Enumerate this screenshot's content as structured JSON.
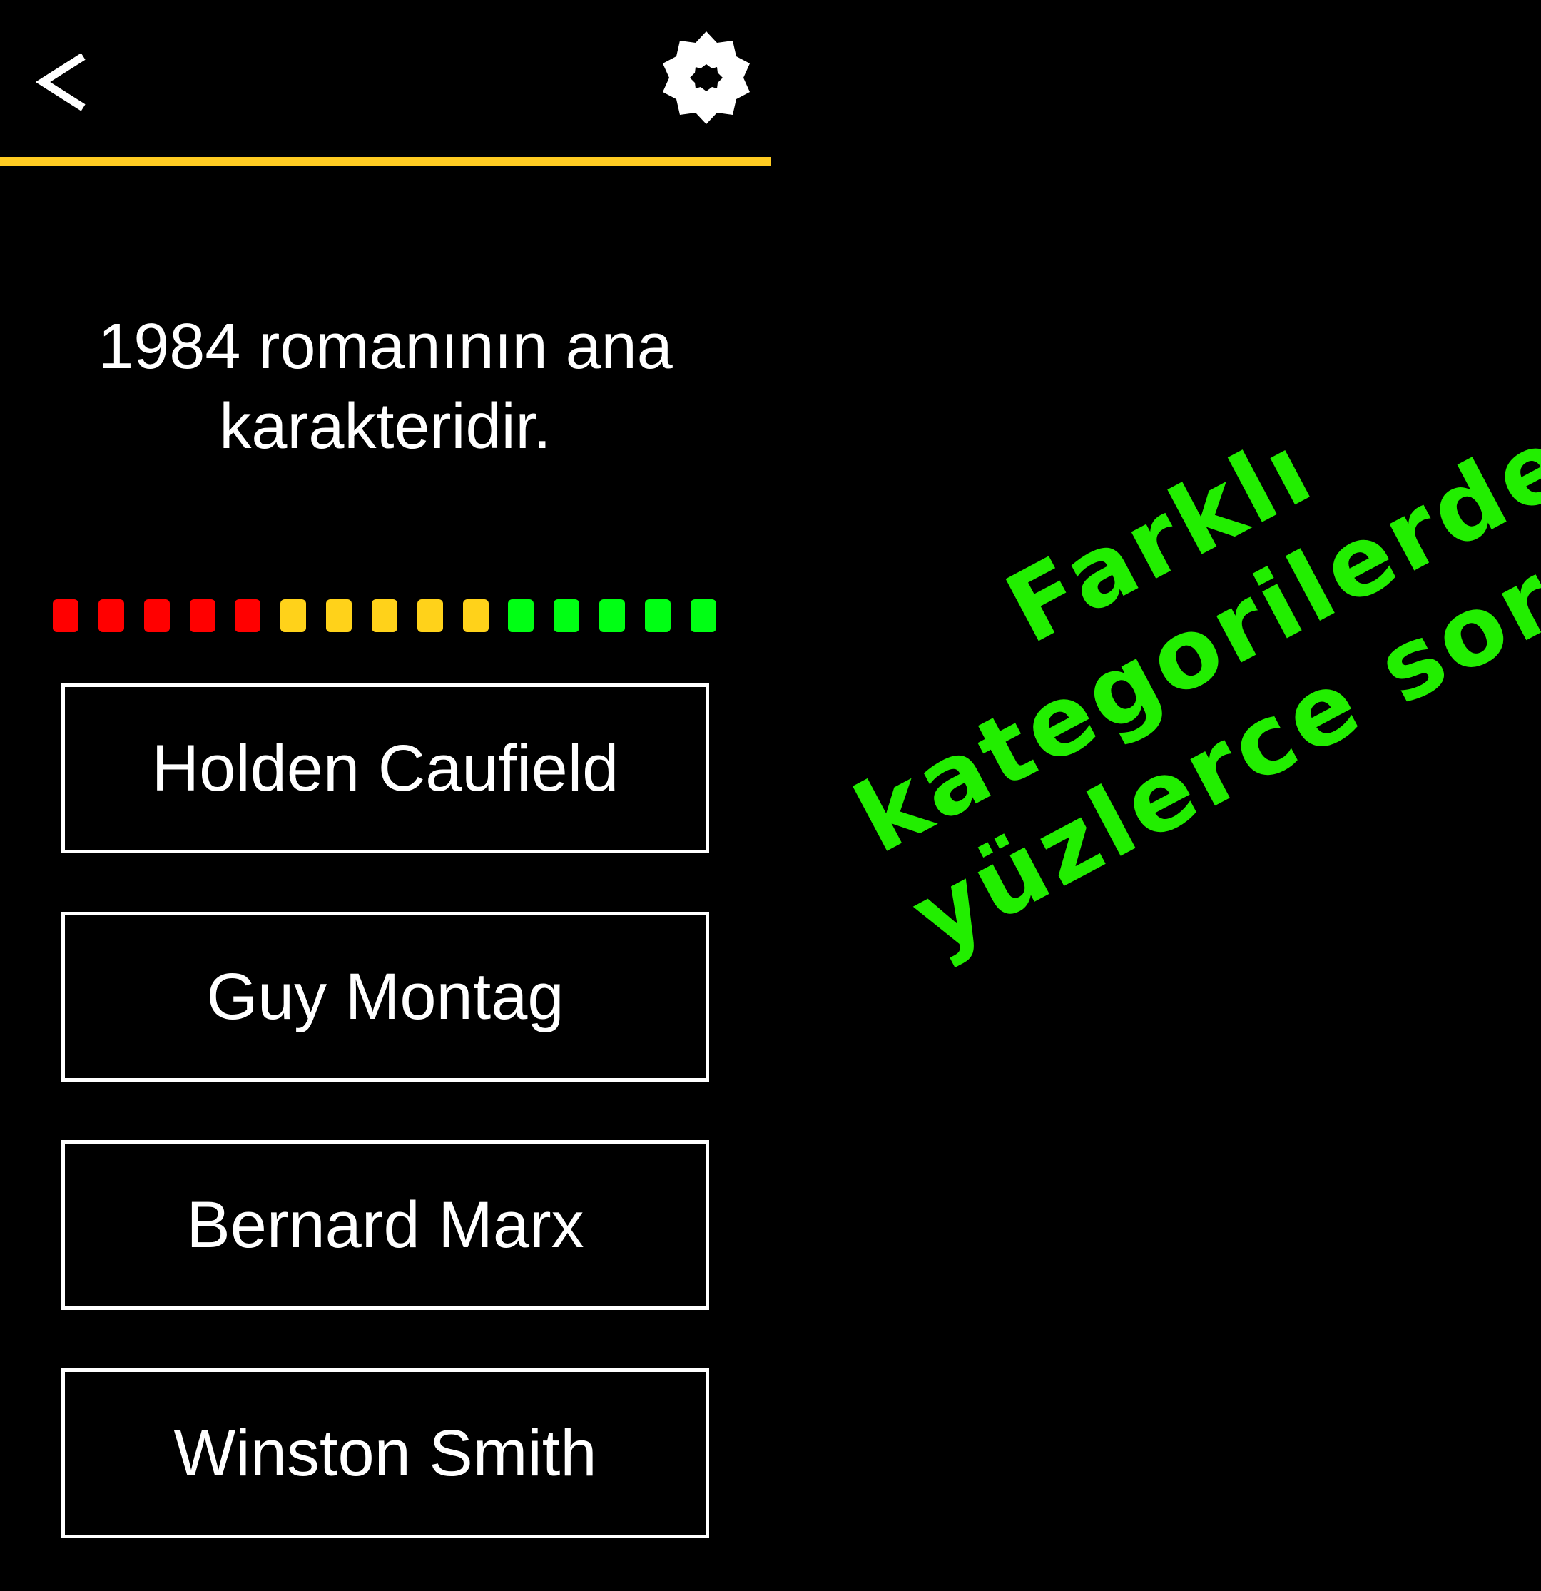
{
  "header": {
    "back_glyph": "<",
    "back_icon": "chevron-left-icon",
    "settings_icon": "gear-icon",
    "divider_color": "#ffcc22"
  },
  "question": {
    "text": "1984 romanının ana karakteridir."
  },
  "timer": {
    "segments": [
      {
        "color": "#ff0000"
      },
      {
        "color": "#ff0000"
      },
      {
        "color": "#ff0000"
      },
      {
        "color": "#ff0000"
      },
      {
        "color": "#ff0000"
      },
      {
        "color": "#ffd21a"
      },
      {
        "color": "#ffd21a"
      },
      {
        "color": "#ffd21a"
      },
      {
        "color": "#ffd21a"
      },
      {
        "color": "#ffd21a"
      },
      {
        "color": "#00ff14"
      },
      {
        "color": "#00ff14"
      },
      {
        "color": "#00ff14"
      },
      {
        "color": "#00ff14"
      },
      {
        "color": "#00ff14"
      }
    ]
  },
  "answers": [
    {
      "label": "Holden Caufield"
    },
    {
      "label": "Guy Montag"
    },
    {
      "label": "Bernard Marx"
    },
    {
      "label": "Winston Smith"
    }
  ],
  "promo": {
    "lines": [
      "Farklı",
      "kategorilerde",
      "yüzlerce soru"
    ],
    "color": "#22ee00"
  }
}
